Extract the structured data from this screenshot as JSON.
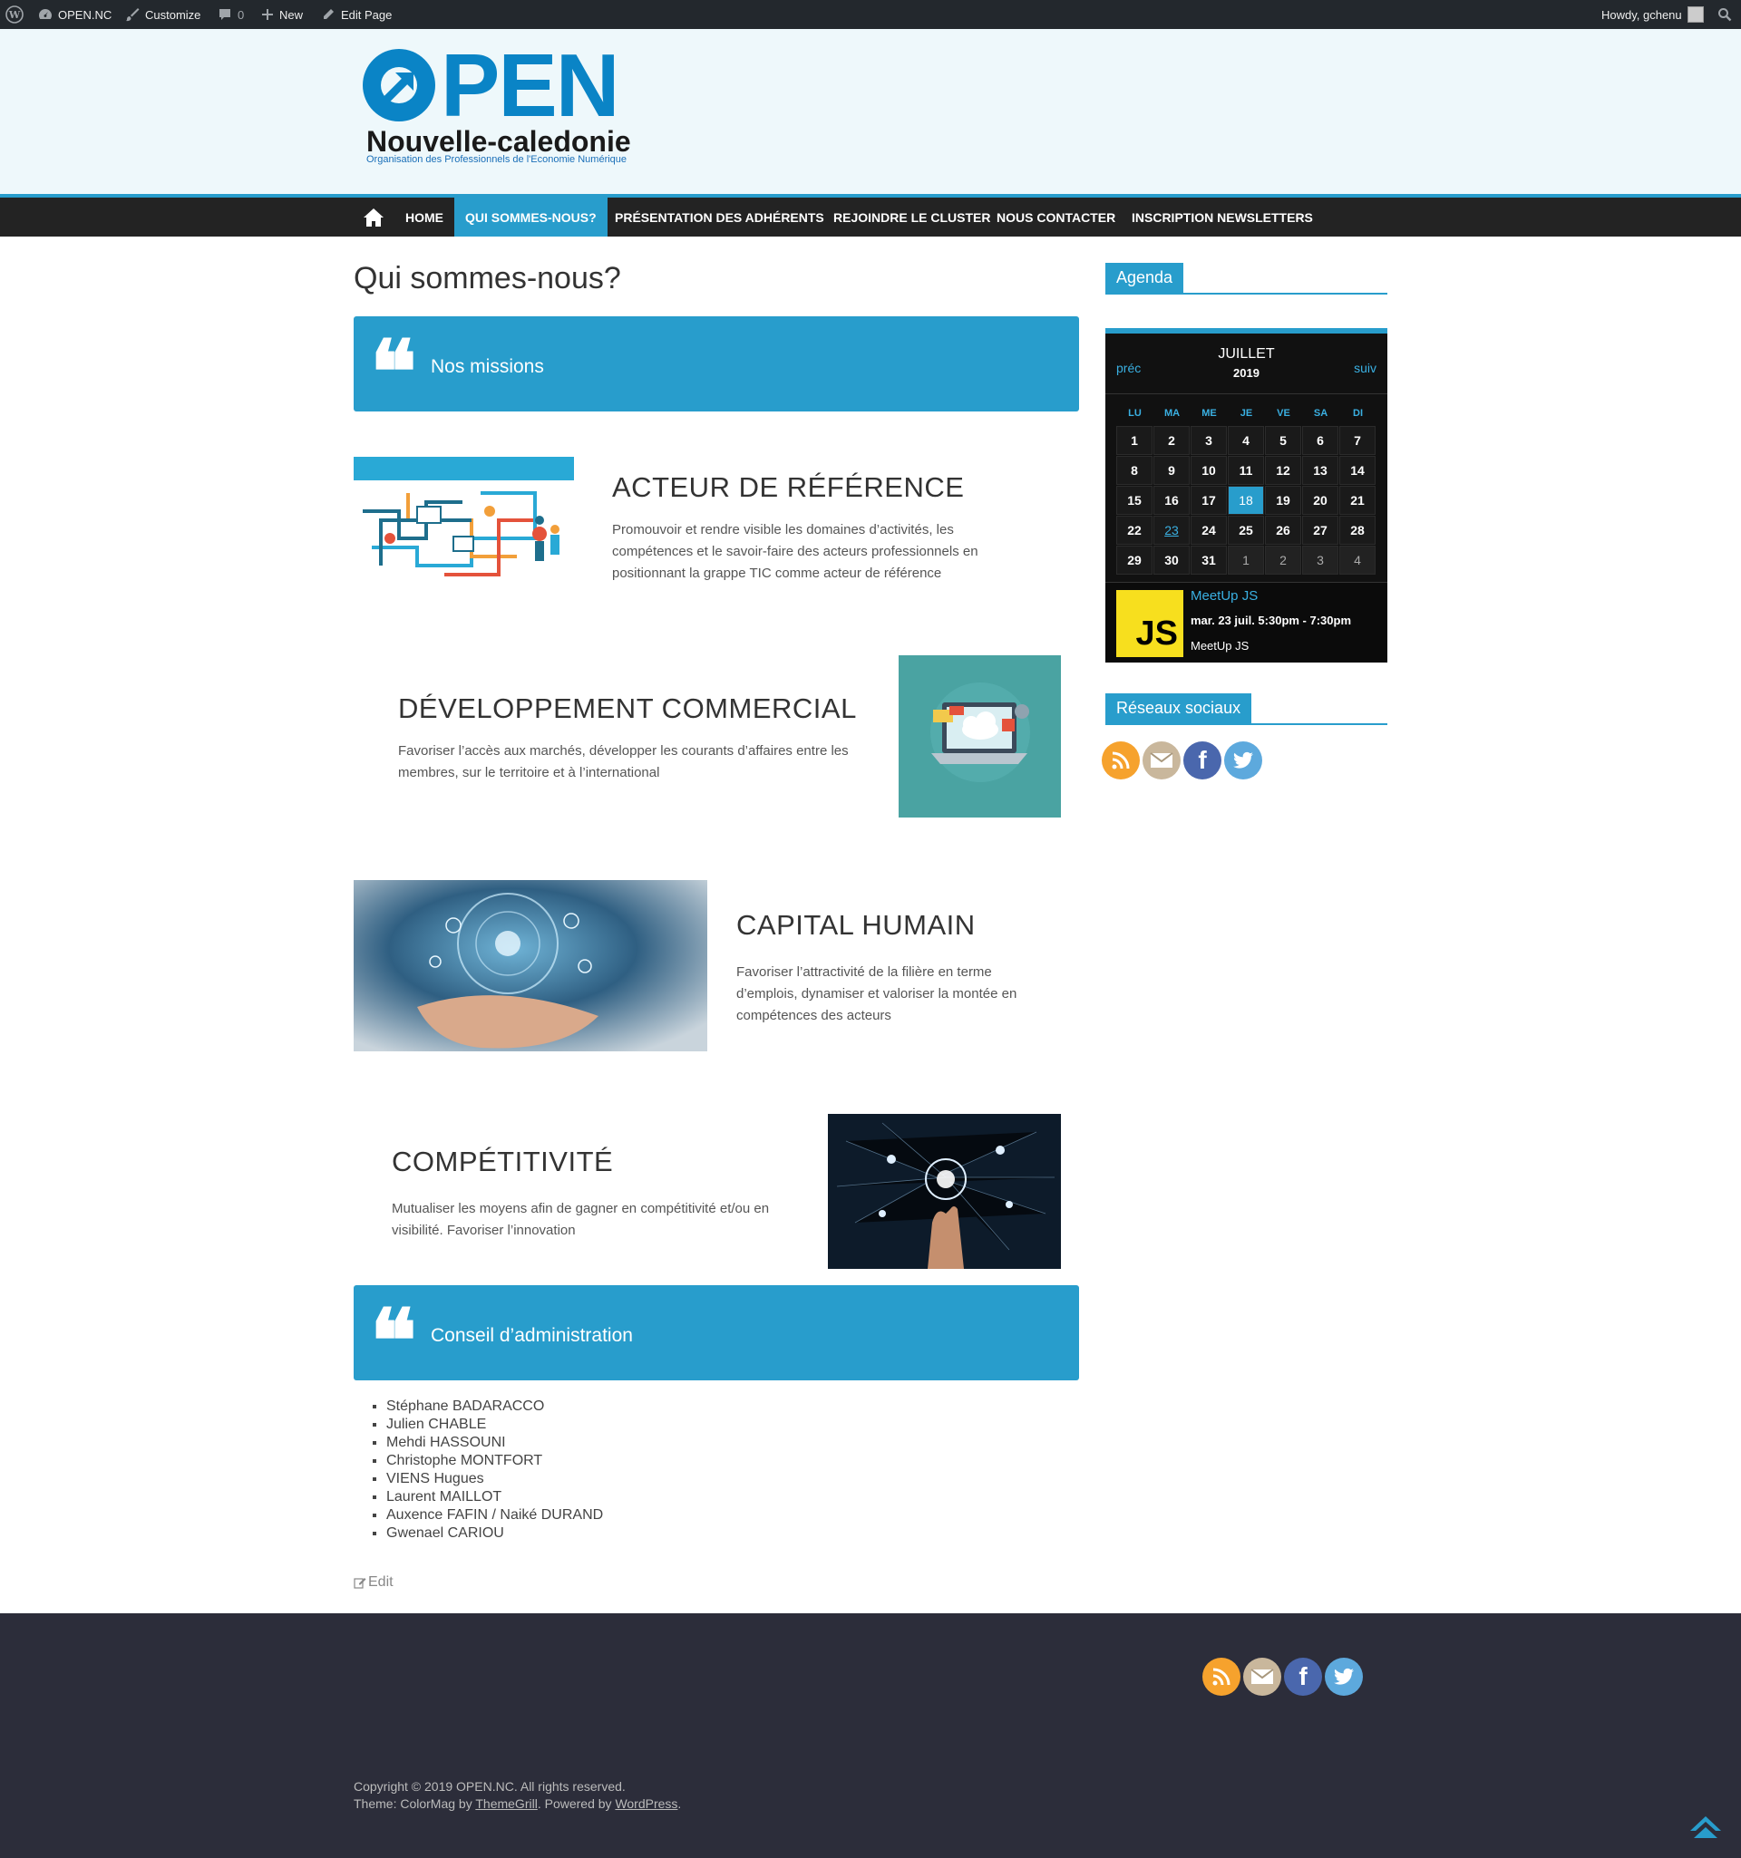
{
  "adminbar": {
    "site": "OPEN.NC",
    "customize": "Customize",
    "comments": "0",
    "new": "New",
    "edit_page": "Edit Page",
    "howdy": "Howdy, gchenu"
  },
  "header": {
    "logo_big": "PEN",
    "logo_sub": "Nouvelle-caledonie",
    "logo_tagline": "Organisation des Professionnels de l'Economie Numérique"
  },
  "nav": {
    "items": [
      {
        "label": "HOME"
      },
      {
        "label": "QUI SOMMES-NOUS?",
        "active": true
      },
      {
        "label": "PRÉSENTATION DES ADHÉRENTS"
      },
      {
        "label": "REJOINDRE LE CLUSTER"
      },
      {
        "label": "NOUS CONTACTER"
      },
      {
        "label": "INSCRIPTION NEWSLETTERS"
      }
    ]
  },
  "main": {
    "title": "Qui sommes-nous?",
    "missions_label": "Nos missions",
    "features": [
      {
        "title": "ACTEUR DE RÉFÉRENCE",
        "text": "Promouvoir et rendre visible les domaines d’activités, les compétences et le savoir-faire des acteurs professionnels en positionnant la grappe TIC comme acteur de référence"
      },
      {
        "title": "DÉVELOPPEMENT COMMERCIAL",
        "text": "Favoriser l’accès aux marchés, développer les courants d’affaires entre les membres, sur le territoire et à l’international"
      },
      {
        "title": "CAPITAL HUMAIN",
        "text": "Favoriser l’attractivité de la filière en terme d’emplois, dynamiser et valoriser la montée en compétences des acteurs"
      },
      {
        "title": "COMPÉTITIVITÉ",
        "text": "Mutualiser les moyens afin de gagner en compétitivité et/ou en visibilité. Favoriser l’innovation"
      }
    ],
    "board_label": "Conseil d’administration",
    "board_members": [
      "Stéphane BADARACCO",
      "Julien CHABLE",
      "Mehdi HASSOUNI",
      "Christophe MONTFORT",
      "VIENS Hugues",
      "Laurent MAILLOT",
      "Auxence FAFIN / Naiké DURAND",
      "Gwenael CARIOU"
    ],
    "edit": "Edit"
  },
  "sidebar": {
    "agenda_title": "Agenda",
    "calendar": {
      "prev": "préc",
      "next": "suiv",
      "month": "JUILLET",
      "year": "2019",
      "weekdays": [
        "LU",
        "MA",
        "ME",
        "JE",
        "VE",
        "SA",
        "DI"
      ],
      "weeks": [
        [
          "1",
          "2",
          "3",
          "4",
          "5",
          "6",
          "7"
        ],
        [
          "8",
          "9",
          "10",
          "11",
          "12",
          "13",
          "14"
        ],
        [
          "15",
          "16",
          "17",
          "18",
          "19",
          "20",
          "21"
        ],
        [
          "22",
          "23",
          "24",
          "25",
          "26",
          "27",
          "28"
        ],
        [
          "29",
          "30",
          "31",
          "1",
          "2",
          "3",
          "4"
        ]
      ],
      "today": "18",
      "event_day": "23"
    },
    "event": {
      "image_text": "JS",
      "title": "MeetUp JS",
      "date": "mar. 23 juil. 5:30pm - 7:30pm",
      "description": "MeetUp JS"
    },
    "social_title": "Réseaux sociaux",
    "social_icons": [
      "rss-icon",
      "email-icon",
      "facebook-icon",
      "twitter-icon"
    ]
  },
  "footer": {
    "copyright_prefix": "Copyright © 2019 ",
    "site_link": "OPEN.NC",
    "copyright_suffix": ". All rights reserved.",
    "theme_prefix": "Theme: ColorMag by ",
    "theme_link": "ThemeGrill",
    "powered": ". Powered by ",
    "wp_link": "WordPress",
    "end": "."
  },
  "colors": {
    "accent": "#289dcc",
    "nav_bg": "#232323",
    "footer_bg": "#2c2d3a",
    "header_bg": "#eef8fb"
  }
}
